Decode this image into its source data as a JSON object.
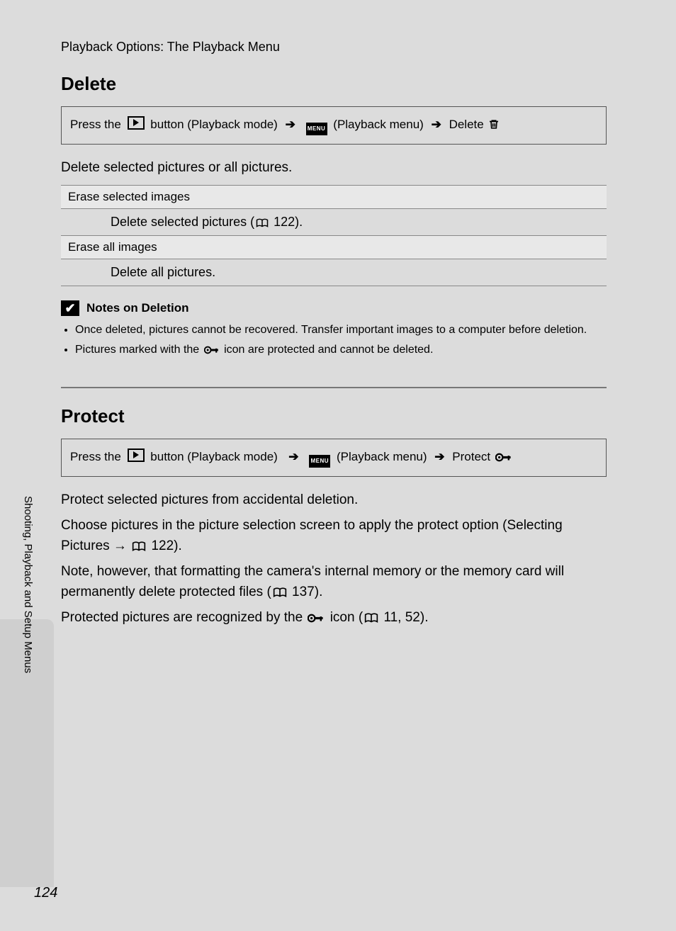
{
  "breadcrumb": "Playback Options: The Playback Menu",
  "sidebar_label": "Shooting, Playback and Setup Menus",
  "page_number": "124",
  "delete": {
    "heading": "Delete",
    "nav_press": "Press the",
    "nav_button_mode": "button (Playback mode)",
    "nav_playback_menu": "(Playback menu)",
    "nav_action": "Delete",
    "intro": "Delete selected pictures or all pictures.",
    "opt1_head": "Erase selected images",
    "opt1_desc_a": "Delete selected pictures (",
    "opt1_desc_b": " 122).",
    "opt2_head": "Erase all images",
    "opt2_desc": "Delete all pictures.",
    "notes_title": "Notes on Deletion",
    "note1": "Once deleted, pictures cannot be recovered. Transfer important images to a computer before deletion.",
    "note2_a": "Pictures marked with the ",
    "note2_b": " icon are protected and cannot be deleted."
  },
  "protect": {
    "heading": "Protect",
    "nav_press": "Press the",
    "nav_button_mode": "button (Playback mode)",
    "nav_playback_menu": "(Playback menu)",
    "nav_action": "Protect",
    "intro": "Protect selected pictures from accidental deletion.",
    "p2_a": "Choose pictures in the picture selection screen to apply the protect option (Selecting Pictures → ",
    "p2_b": " 122).",
    "p3_a": "Note, however, that formatting the camera's internal memory or the memory card will permanently delete protected files (",
    "p3_b": " 137).",
    "p4_a": "Protected pictures are recognized by the ",
    "p4_b": " icon (",
    "p4_c": " 11, 52)."
  },
  "icons": {
    "menu_label": "MENU"
  }
}
